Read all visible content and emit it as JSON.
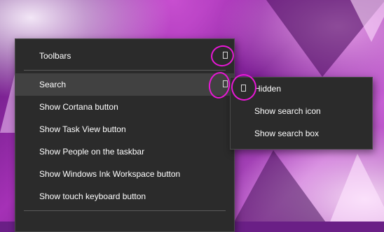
{
  "main_menu": {
    "items": [
      {
        "label": "Toolbars",
        "has_submenu": true
      },
      {
        "label": "Search",
        "has_submenu": true,
        "highlighted": true
      },
      {
        "label": "Show Cortana button"
      },
      {
        "label": "Show Task View button"
      },
      {
        "label": "Show People on the taskbar"
      },
      {
        "label": "Show Windows Ink Workspace button"
      },
      {
        "label": "Show touch keyboard button"
      }
    ]
  },
  "search_submenu": {
    "items": [
      {
        "label": "Hidden",
        "checked": true
      },
      {
        "label": "Show search icon"
      },
      {
        "label": "Show search box"
      }
    ]
  },
  "icons": {
    "submenu_arrow": "chevron-right-icon",
    "checkmark": "check-icon"
  },
  "colors": {
    "menu_background": "#2b2b2b",
    "menu_hover": "#414141",
    "menu_text": "#ffffff",
    "annotation": "#e818d6"
  }
}
